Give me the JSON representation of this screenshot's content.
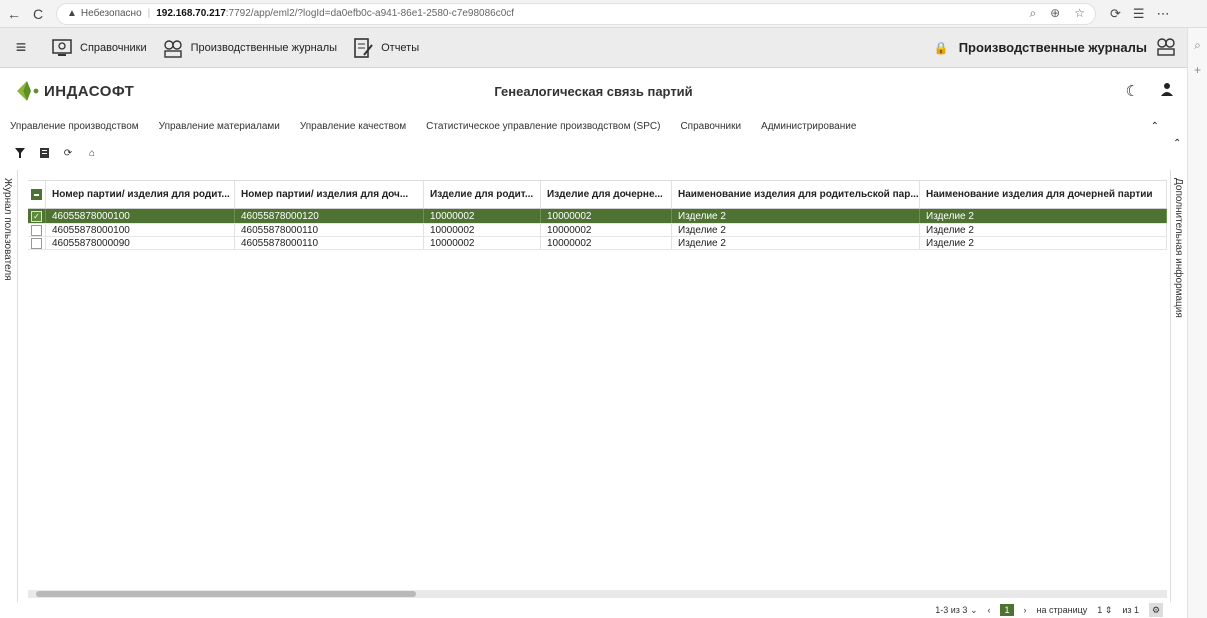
{
  "browser": {
    "back": "←",
    "reload": "C",
    "warn_icon": "▲",
    "insecure": "Небезопасно",
    "host": "192.168.70.217",
    "path": ":7792/app/eml2/?logId=da0efb0c-a941-86e1-2580-c7e98086c0cf"
  },
  "top_menu": {
    "items": [
      {
        "label": "Справочники",
        "icon": "catalog-icon"
      },
      {
        "label": "Производственные журналы",
        "icon": "gears-icon"
      },
      {
        "label": "Отчеты",
        "icon": "report-icon"
      }
    ],
    "right_label": "Производственные журналы"
  },
  "header": {
    "logo_text": "ИНДАСОФТ",
    "title": "Генеалогическая связь партий"
  },
  "module_menu": [
    "Управление производством",
    "Управление материалами",
    "Управление качеством",
    "Статистическое управление производством (SPC)",
    "Справочники",
    "Администрирование"
  ],
  "side": {
    "left": "Журнал пользователя",
    "right": "Дополнительная информация"
  },
  "grid": {
    "columns": [
      "Номер партии/ изделия для родит...",
      "Номер партии/ изделия для доч...",
      "Изделие для родит...",
      "Изделие для дочерне...",
      "Наименование изделия для родительской пар...",
      "Наименование изделия для дочерней партии"
    ],
    "rows": [
      [
        "46055878000100",
        "46055878000120",
        "10000002",
        "10000002",
        "Изделие 2",
        "Изделие 2"
      ],
      [
        "46055878000100",
        "46055878000110",
        "10000002",
        "10000002",
        "Изделие 2",
        "Изделие 2"
      ],
      [
        "46055878000090",
        "46055878000110",
        "10000002",
        "10000002",
        "Изделие 2",
        "Изделие 2"
      ]
    ],
    "selected_row": 0
  },
  "pager": {
    "range": "1-3 из 3",
    "current_page": "1",
    "per_page_label": "на страницу",
    "per_page_value": "1",
    "of_pages": "из 1"
  },
  "colors": {
    "accent": "#4d7232"
  }
}
